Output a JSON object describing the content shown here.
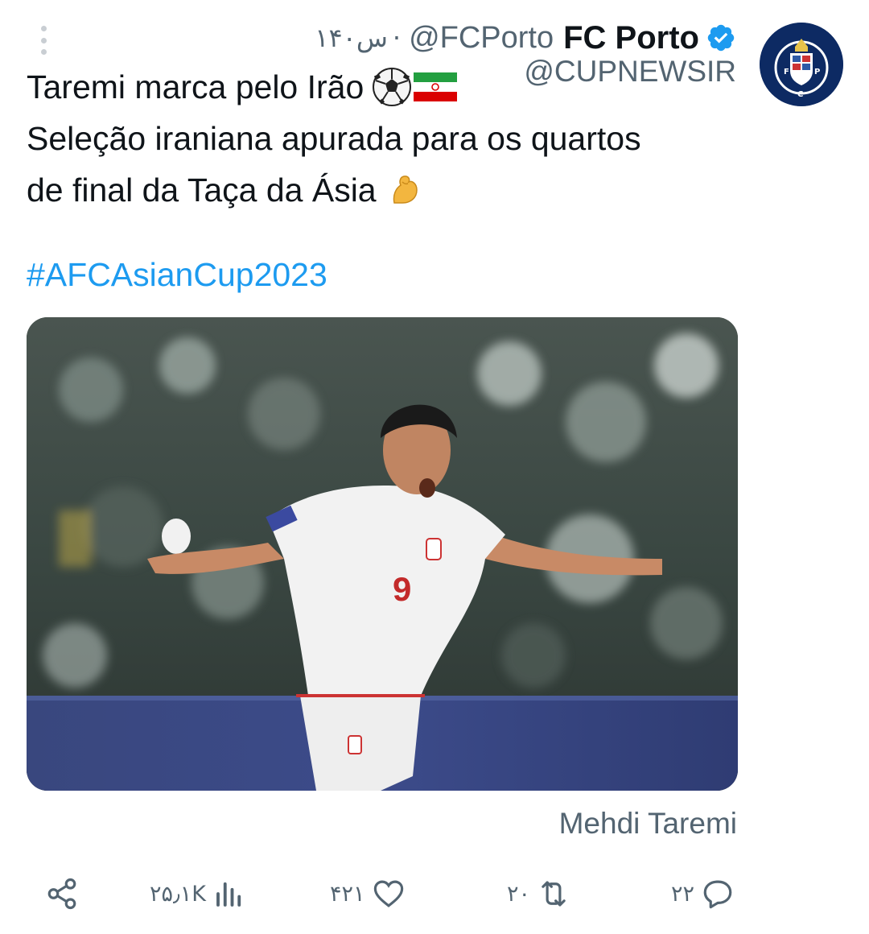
{
  "header": {
    "time": "۱۴۰س",
    "separator": "·",
    "handle": "@FCPorto",
    "author_name": "FC Porto",
    "verified_icon": "verified-badge-icon",
    "source_handle": "@CUPNEWSIR"
  },
  "tweet": {
    "line1": "Taremi marca pelo Irão",
    "line2": "Seleção iraniana apurada para os quartos",
    "line3": "de final da Taça da Ásia",
    "hashtag": "#AFCAsianCup2023",
    "emojis": [
      "soccer-ball-icon",
      "iran-flag-icon",
      "flexed-biceps-icon"
    ]
  },
  "media": {
    "caption": "Mehdi Taremi",
    "jersey_number": "9"
  },
  "actions": {
    "share_icon": "share-icon",
    "views_count": "۲۵٫۱K",
    "likes_count": "۴۲۱",
    "reposts_count": "۲۰",
    "replies_count": "۲۲"
  },
  "colors": {
    "link": "#1d9bf0",
    "secondary_text": "#536471",
    "verified": "#1d9bf0",
    "avatar_bg": "#0d2a63"
  }
}
